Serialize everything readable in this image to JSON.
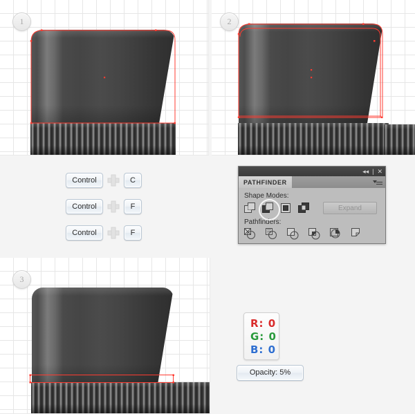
{
  "steps": [
    {
      "number": "1"
    },
    {
      "number": "2"
    },
    {
      "number": "3"
    }
  ],
  "shortcuts": [
    {
      "modifier": "Control",
      "separator": "plus-icon",
      "key": "C"
    },
    {
      "modifier": "Control",
      "separator": "plus-icon",
      "key": "F"
    },
    {
      "modifier": "Control",
      "separator": "plus-icon",
      "key": "F"
    }
  ],
  "pathfinder": {
    "title": "PATHFINDER",
    "collapse_icon": "◂◂",
    "divider": "|",
    "close_icon": "✕",
    "shape_modes_label": "Shape Modes:",
    "pathfinders_label": "Pathfinders:",
    "expand_label": "Expand",
    "shape_modes": [
      {
        "name": "unite",
        "selected": false
      },
      {
        "name": "minus-front",
        "selected": true
      },
      {
        "name": "intersect",
        "selected": false
      },
      {
        "name": "exclude",
        "selected": false
      }
    ],
    "pathfinders": [
      {
        "name": "divide"
      },
      {
        "name": "trim"
      },
      {
        "name": "merge"
      },
      {
        "name": "crop"
      },
      {
        "name": "outline"
      },
      {
        "name": "minus-back"
      }
    ]
  },
  "color_readout": {
    "r_label": "R:",
    "r_value": "0",
    "r_color": "#d92b2b",
    "g_label": "G:",
    "g_value": "0",
    "g_color": "#2a9a3c",
    "b_label": "B:",
    "b_value": "0",
    "b_color": "#2f6fd0"
  },
  "opacity": {
    "label": "Opacity: 5%"
  },
  "artwork": {
    "path_stroke_color": "#ff3b30",
    "anchor_color": "#ff3b30"
  }
}
